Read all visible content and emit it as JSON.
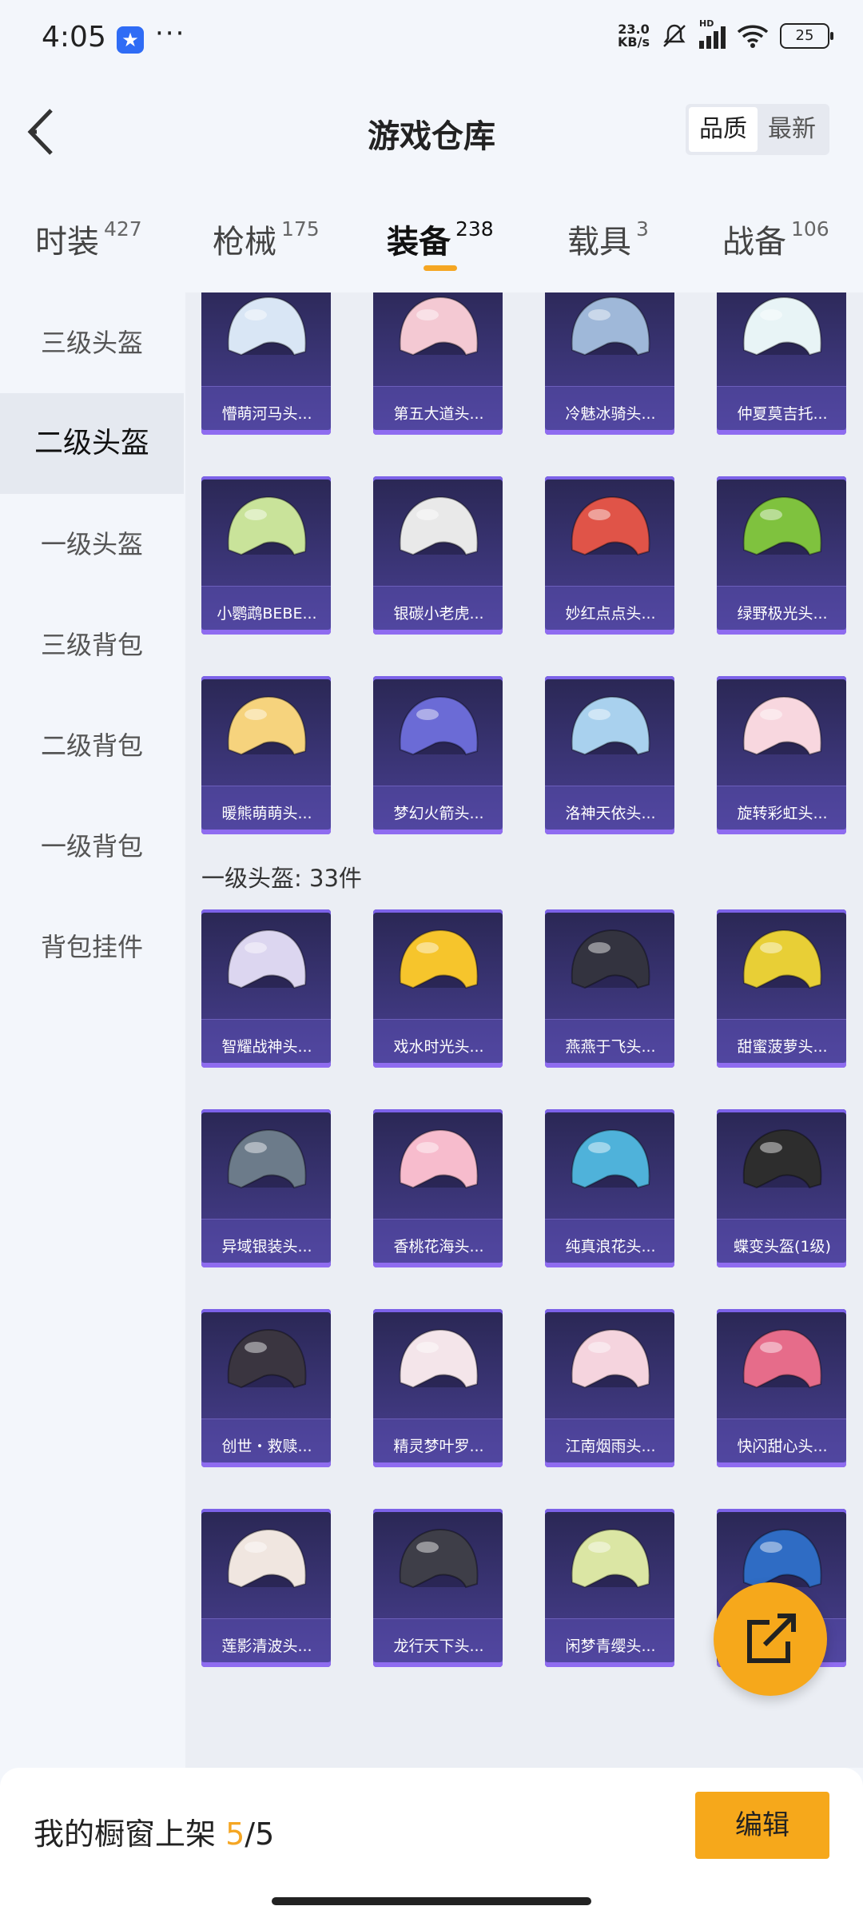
{
  "status": {
    "time": "4:05",
    "speed_top": "23.0",
    "speed_bottom": "KB/s",
    "network": "HD",
    "battery": "25"
  },
  "header": {
    "title": "游戏仓库",
    "sort_quality": "品质",
    "sort_newest": "最新"
  },
  "tabs": [
    {
      "label": "时装",
      "count": "427"
    },
    {
      "label": "枪械",
      "count": "175"
    },
    {
      "label": "装备",
      "count": "238"
    },
    {
      "label": "载具",
      "count": "3"
    },
    {
      "label": "战备",
      "count": "106"
    }
  ],
  "sidebar": [
    "三级头盔",
    "二级头盔",
    "一级头盔",
    "三级背包",
    "二级背包",
    "一级背包",
    "背包挂件"
  ],
  "level2_items": [
    "懵萌河马头...",
    "第五大道头...",
    "冷魅冰骑头...",
    "仲夏莫吉托...",
    "小鹦鹉BEBE...",
    "银碳小老虎...",
    "妙红点点头...",
    "绿野极光头...",
    "暖熊萌萌头...",
    "梦幻火箭头...",
    "洛神天依头...",
    "旋转彩虹头..."
  ],
  "section": {
    "title": "一级头盔: 33件"
  },
  "level1_items": [
    "智耀战神头...",
    "戏水时光头...",
    "燕燕于飞头...",
    "甜蜜菠萝头...",
    "异域银装头...",
    "香桃花海头...",
    "纯真浪花头...",
    "蝶变头盔(1级)",
    "创世・救赎...",
    "精灵梦叶罗...",
    "江南烟雨头...",
    "快闪甜心头...",
    "莲影清波头...",
    "龙行天下头...",
    "闲梦青缨头...",
    ""
  ],
  "footer": {
    "label": "我的橱窗上架",
    "current": "5",
    "total": "/5",
    "edit": "编辑"
  },
  "colors": {
    "accent": "#f6a81b",
    "card_bg": "#3b3577"
  }
}
